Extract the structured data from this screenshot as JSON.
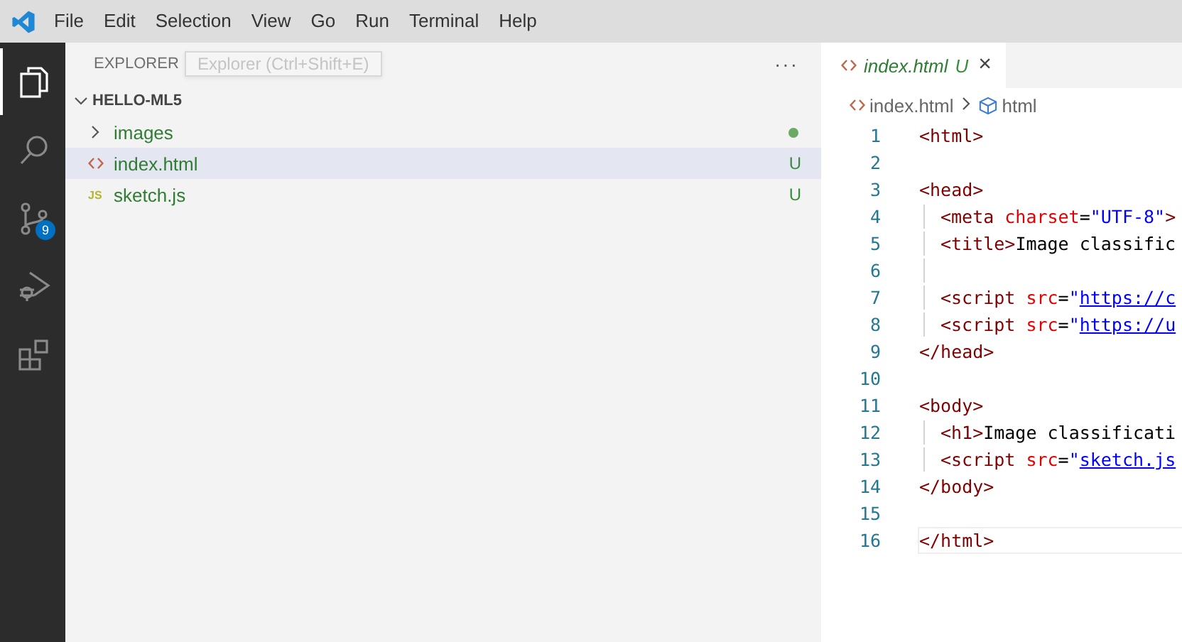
{
  "menu": [
    "File",
    "Edit",
    "Selection",
    "View",
    "Go",
    "Run",
    "Terminal",
    "Help"
  ],
  "activity_bar": [
    {
      "kind": "files",
      "selected": true
    },
    {
      "kind": "search",
      "selected": false
    },
    {
      "kind": "source-control",
      "selected": false,
      "badge": "9"
    },
    {
      "kind": "debug",
      "selected": false
    },
    {
      "kind": "extensions",
      "selected": false
    }
  ],
  "sidebar": {
    "title": "EXPLORER",
    "tooltip": "Explorer (Ctrl+Shift+E)",
    "more": "···",
    "folder": {
      "name": "HELLO-ML5",
      "expanded": true,
      "items": [
        {
          "kind": "folder",
          "name": "images",
          "expanded": false,
          "selected": false,
          "modified_dot": true
        },
        {
          "kind": "html",
          "name": "index.html",
          "selected": true,
          "modified_dot": false,
          "status": "U"
        },
        {
          "kind": "js",
          "name": "sketch.js",
          "icon_text": "JS",
          "selected": false,
          "modified_dot": false,
          "status": "U"
        }
      ]
    }
  },
  "editor": {
    "tabs": [
      {
        "name": "index.html",
        "status": "U",
        "selected": true,
        "close": "×"
      }
    ],
    "breadcrumb": [
      {
        "kind": "file",
        "text": "index.html"
      },
      {
        "kind": "element",
        "text": "html"
      }
    ],
    "lines": [
      {
        "number": "1",
        "indent": false,
        "current": false,
        "tokens": [
          {
            "kind": "tag",
            "text": "<html>"
          }
        ]
      },
      {
        "number": "2",
        "indent": false,
        "current": false
      },
      {
        "number": "3",
        "indent": false,
        "current": false,
        "tokens": [
          {
            "kind": "tag",
            "text": "<head>"
          }
        ]
      },
      {
        "number": "4",
        "indent": true,
        "current": false,
        "tokens": [
          {
            "kind": "tag",
            "text": "<meta "
          },
          {
            "kind": "attr",
            "text": "charset"
          },
          {
            "kind": "text",
            "text": "="
          },
          {
            "kind": "string",
            "text": "\"UTF-8\""
          },
          {
            "kind": "tag",
            "text": ">"
          }
        ]
      },
      {
        "number": "5",
        "indent": true,
        "current": false,
        "tokens": [
          {
            "kind": "tag",
            "text": "<title>"
          },
          {
            "kind": "text",
            "text": "Image classific"
          }
        ]
      },
      {
        "number": "6",
        "indent": true,
        "current": false
      },
      {
        "number": "7",
        "indent": true,
        "current": false,
        "tokens": [
          {
            "kind": "tag",
            "text": "<script "
          },
          {
            "kind": "attr",
            "text": "src"
          },
          {
            "kind": "text",
            "text": "="
          },
          {
            "kind": "string",
            "text": "\""
          },
          {
            "kind": "link",
            "text": "https://c"
          }
        ]
      },
      {
        "number": "8",
        "indent": true,
        "current": false,
        "tokens": [
          {
            "kind": "tag",
            "text": "<script "
          },
          {
            "kind": "attr",
            "text": "src"
          },
          {
            "kind": "text",
            "text": "="
          },
          {
            "kind": "string",
            "text": "\""
          },
          {
            "kind": "link",
            "text": "https://u"
          }
        ]
      },
      {
        "number": "9",
        "indent": false,
        "current": false,
        "tokens": [
          {
            "kind": "tag",
            "text": "</head>"
          }
        ]
      },
      {
        "number": "10",
        "indent": false,
        "current": false
      },
      {
        "number": "11",
        "indent": false,
        "current": false,
        "tokens": [
          {
            "kind": "tag",
            "text": "<body>"
          }
        ]
      },
      {
        "number": "12",
        "indent": true,
        "current": false,
        "tokens": [
          {
            "kind": "tag",
            "text": "<h1>"
          },
          {
            "kind": "text",
            "text": "Image classificati"
          }
        ]
      },
      {
        "number": "13",
        "indent": true,
        "current": false,
        "tokens": [
          {
            "kind": "tag",
            "text": "<script "
          },
          {
            "kind": "attr",
            "text": "src"
          },
          {
            "kind": "text",
            "text": "="
          },
          {
            "kind": "string",
            "text": "\""
          },
          {
            "kind": "link",
            "text": "sketch.js"
          }
        ]
      },
      {
        "number": "14",
        "indent": false,
        "current": false,
        "tokens": [
          {
            "kind": "tag",
            "text": "</body>"
          }
        ]
      },
      {
        "number": "15",
        "indent": false,
        "current": false
      },
      {
        "number": "16",
        "indent": false,
        "current": true,
        "tokens": [
          {
            "kind": "tag",
            "text": "</html>"
          }
        ]
      }
    ]
  }
}
